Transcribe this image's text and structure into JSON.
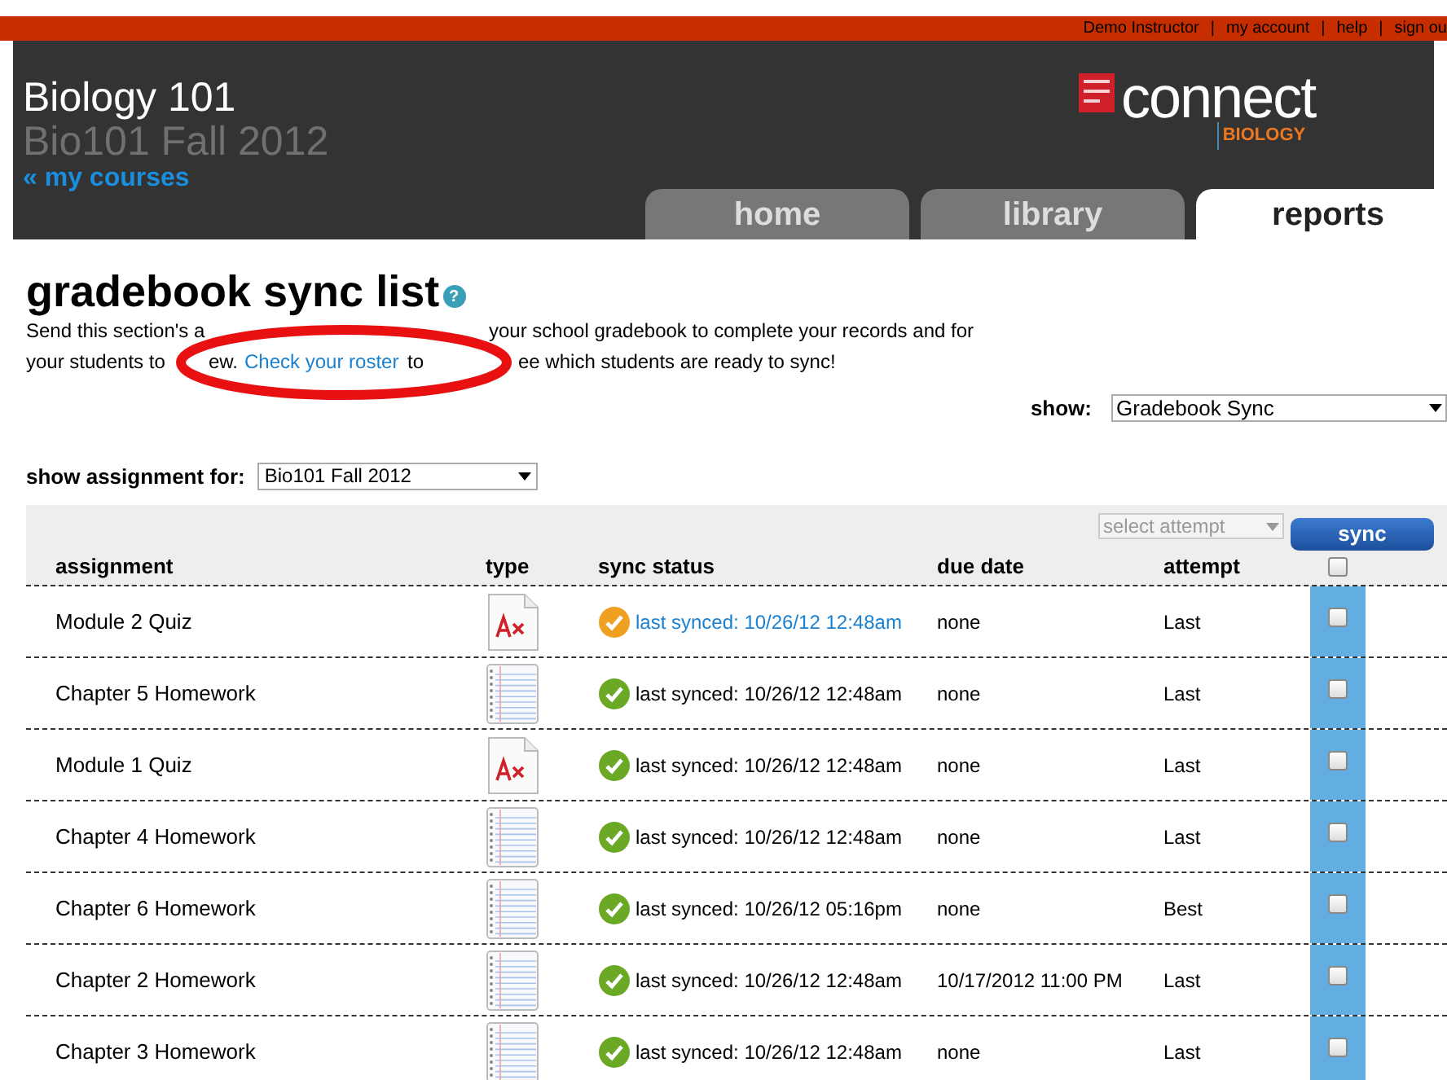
{
  "top_links": [
    "Demo Instructor",
    "my account",
    "help",
    "sign ou"
  ],
  "top_separator": "|",
  "course": {
    "title": "Biology 101",
    "section": "Bio101 Fall 2012",
    "back_link": "« my courses"
  },
  "logo": {
    "wordmark": "connect",
    "subject": "BIOLOGY"
  },
  "tabs": [
    {
      "label": "home",
      "selected": false
    },
    {
      "label": "library",
      "selected": false
    },
    {
      "label": "reports",
      "selected": true
    }
  ],
  "page_title": "gradebook sync list",
  "help_icon": "?",
  "description": {
    "line1_start": "Send this section's a",
    "line1_end": "your school gradebook to complete your records and for",
    "line2_start": "your students to",
    "line2_mid": "ew.",
    "link": "Check your roster",
    "line2_after": "to",
    "line2_end": "ee which students are ready to sync!"
  },
  "show": {
    "label": "show:",
    "value": "Gradebook Sync"
  },
  "assignment_filter": {
    "label": "show assignment for:",
    "value": "Bio101 Fall 2012"
  },
  "toolbar": {
    "attempt_select": {
      "placeholder": "select attempt",
      "disabled": true
    },
    "sync_button": "sync"
  },
  "table": {
    "columns": [
      "assignment",
      "type",
      "sync status",
      "due date",
      "attempt"
    ],
    "select_all_checked": false,
    "rows": [
      {
        "assignment": "Module 2 Quiz",
        "kind": "quiz",
        "color": "#f0a020",
        "link": true,
        "sync_status": "last synced: 10/26/12 12:48am",
        "due_date": "none",
        "attempt": "Last",
        "checked": false
      },
      {
        "assignment": "Chapter 5 Homework",
        "kind": "homework",
        "color": "#6aa826",
        "link": false,
        "sync_status": "last synced: 10/26/12 12:48am",
        "due_date": "none",
        "attempt": "Last",
        "checked": false
      },
      {
        "assignment": "Module 1 Quiz",
        "kind": "quiz",
        "color": "#6aa826",
        "link": false,
        "sync_status": "last synced: 10/26/12 12:48am",
        "due_date": "none",
        "attempt": "Last",
        "checked": false
      },
      {
        "assignment": "Chapter 4 Homework",
        "kind": "homework",
        "color": "#6aa826",
        "link": false,
        "sync_status": "last synced: 10/26/12 12:48am",
        "due_date": "none",
        "attempt": "Last",
        "checked": false
      },
      {
        "assignment": "Chapter 6 Homework",
        "kind": "homework",
        "color": "#6aa826",
        "link": false,
        "sync_status": "last synced: 10/26/12 05:16pm",
        "due_date": "none",
        "attempt": "Best",
        "checked": false
      },
      {
        "assignment": "Chapter 2 Homework",
        "kind": "homework",
        "color": "#6aa826",
        "link": false,
        "sync_status": "last synced: 10/26/12 12:48am",
        "due_date": "10/17/2012 11:00 PM",
        "attempt": "Last",
        "checked": false
      },
      {
        "assignment": "Chapter 3 Homework",
        "kind": "homework",
        "color": "#6aa826",
        "link": false,
        "sync_status": "last synced: 10/26/12 12:48am",
        "due_date": "none",
        "attempt": "Last",
        "checked": false
      }
    ]
  }
}
